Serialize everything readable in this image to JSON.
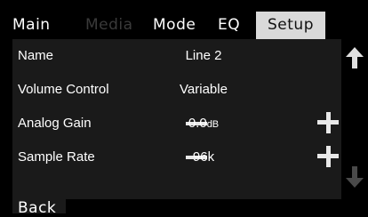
{
  "tabs": [
    {
      "label": "Main",
      "state": "normal"
    },
    {
      "label": "Media",
      "state": "disabled"
    },
    {
      "label": "Mode",
      "state": "normal"
    },
    {
      "label": "EQ",
      "state": "normal"
    },
    {
      "label": "Setup",
      "state": "active"
    }
  ],
  "settings": [
    {
      "label": "Name",
      "value": "Line 2"
    },
    {
      "label": "Volume Control",
      "value": "Variable"
    },
    {
      "label": "Analog Gain",
      "value": "0.0",
      "unit": "dB"
    },
    {
      "label": "Sample Rate",
      "value": "96k"
    }
  ],
  "footer": {
    "back_label": "Back"
  },
  "colors": {
    "background": "#000000",
    "panel": "#1a1a1a",
    "active_tab": "#d9d9d9",
    "disabled_text": "#3a3a3a",
    "scroll_up_arrow": "#e0e0e0",
    "scroll_down_arrow": "#4a4a4a"
  },
  "icons": {
    "scroll_up": "arrow-up-icon",
    "scroll_down": "arrow-down-icon",
    "decrease": "minus-icon",
    "increase": "plus-icon"
  }
}
